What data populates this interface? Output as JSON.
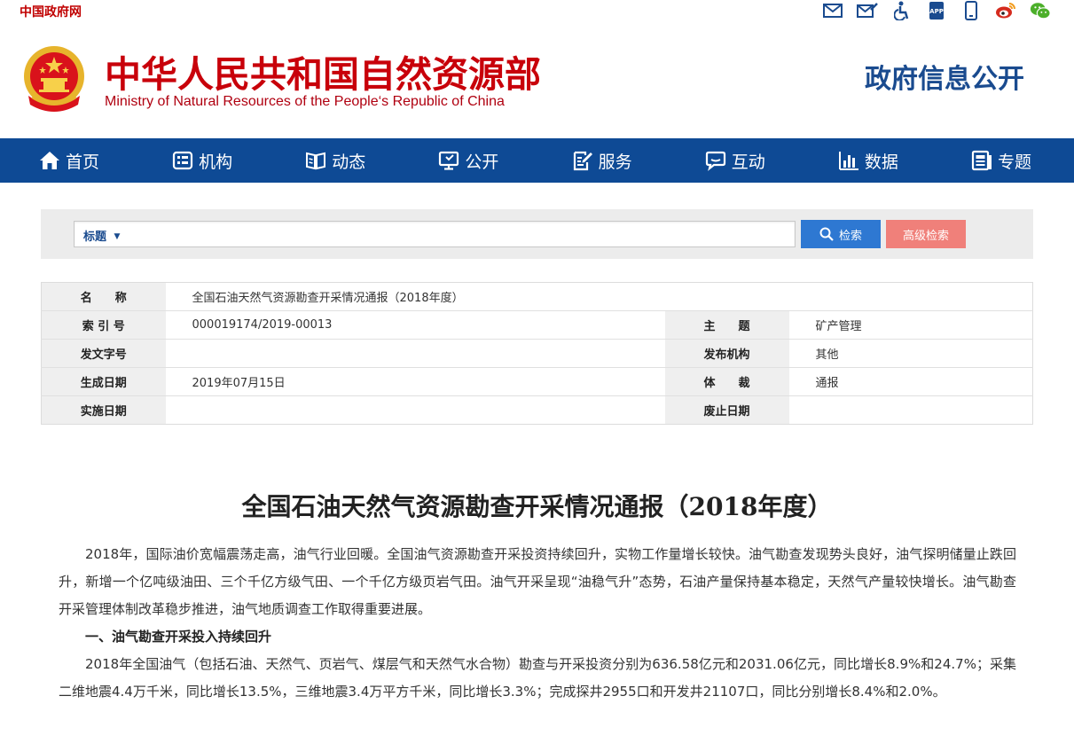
{
  "topbar": {
    "gov_link": "中国政府网",
    "icons": [
      "mail-icon",
      "mail-edit-icon",
      "accessibility-icon",
      "app-icon",
      "mobile-icon",
      "weibo-icon",
      "wechat-icon"
    ]
  },
  "header": {
    "ministry_cn": "中华人民共和国自然资源部",
    "ministry_en": "Ministry of Natural Resources of the People‘s Republic of China",
    "section_title": "政府信息公开"
  },
  "nav": {
    "items": [
      {
        "label": "首页",
        "icon": "home-icon"
      },
      {
        "label": "机构",
        "icon": "organization-icon"
      },
      {
        "label": "动态",
        "icon": "book-icon"
      },
      {
        "label": "公开",
        "icon": "monitor-icon"
      },
      {
        "label": "服务",
        "icon": "edit-document-icon"
      },
      {
        "label": "互动",
        "icon": "chat-icon"
      },
      {
        "label": "数据",
        "icon": "bar-chart-icon"
      },
      {
        "label": "专题",
        "icon": "topic-icon"
      }
    ]
  },
  "search": {
    "field_select": "标题",
    "field_arrow": "▼",
    "placeholder": "",
    "search_label": "检索",
    "advanced_label": "高级检索"
  },
  "info": {
    "name_label": "名　　称",
    "name_value": "全国石油天然气资源勘查开采情况通报（2018年度）",
    "index_label": "索 引 号",
    "index_value": "000019174/2019-00013",
    "subject_label": "主　　题",
    "subject_value": "矿产管理",
    "doc_no_label": "发文字号",
    "doc_no_value": "",
    "issuer_label": "发布机构",
    "issuer_value": "其他",
    "date_label": "生成日期",
    "date_value": "2019年07月15日",
    "genre_label": "体　　裁",
    "genre_value": "通报",
    "effective_label": "实施日期",
    "effective_value": "",
    "expiry_label": "废止日期",
    "expiry_value": ""
  },
  "article": {
    "title": "全国石油天然气资源勘查开采情况通报（2018年度）",
    "para1": "2018年，国际油价宽幅震荡走高，油气行业回暖。全国油气资源勘查开采投资持续回升，实物工作量增长较快。油气勘查发现势头良好，油气探明储量止跌回升，新增一个亿吨级油田、三个千亿方级气田、一个千亿方级页岩气田。油气开采呈现“油稳气升”态势，石油产量保持基本稳定，天然气产量较快增长。油气勘查开采管理体制改革稳步推进，油气地质调查工作取得重要进展。",
    "heading1": "一、油气勘查开采投入持续回升",
    "para2": "2018年全国油气（包括石油、天然气、页岩气、煤层气和天然气水合物）勘查与开采投资分别为636.58亿元和2031.06亿元，同比增长8.9%和24.7%；采集二维地震4.4万千米，同比增长13.5%，三维地震3.4万平方千米，同比增长3.3%；完成探井2955口和开发井21107口，同比分别增长8.4%和2.0%。"
  },
  "colors": {
    "brand_red": "#c8000a",
    "nav_blue": "#0e4a95",
    "search_blue": "#2e78d2",
    "advanced_pink": "#f0807a",
    "title_blue": "#1a4b8f"
  }
}
